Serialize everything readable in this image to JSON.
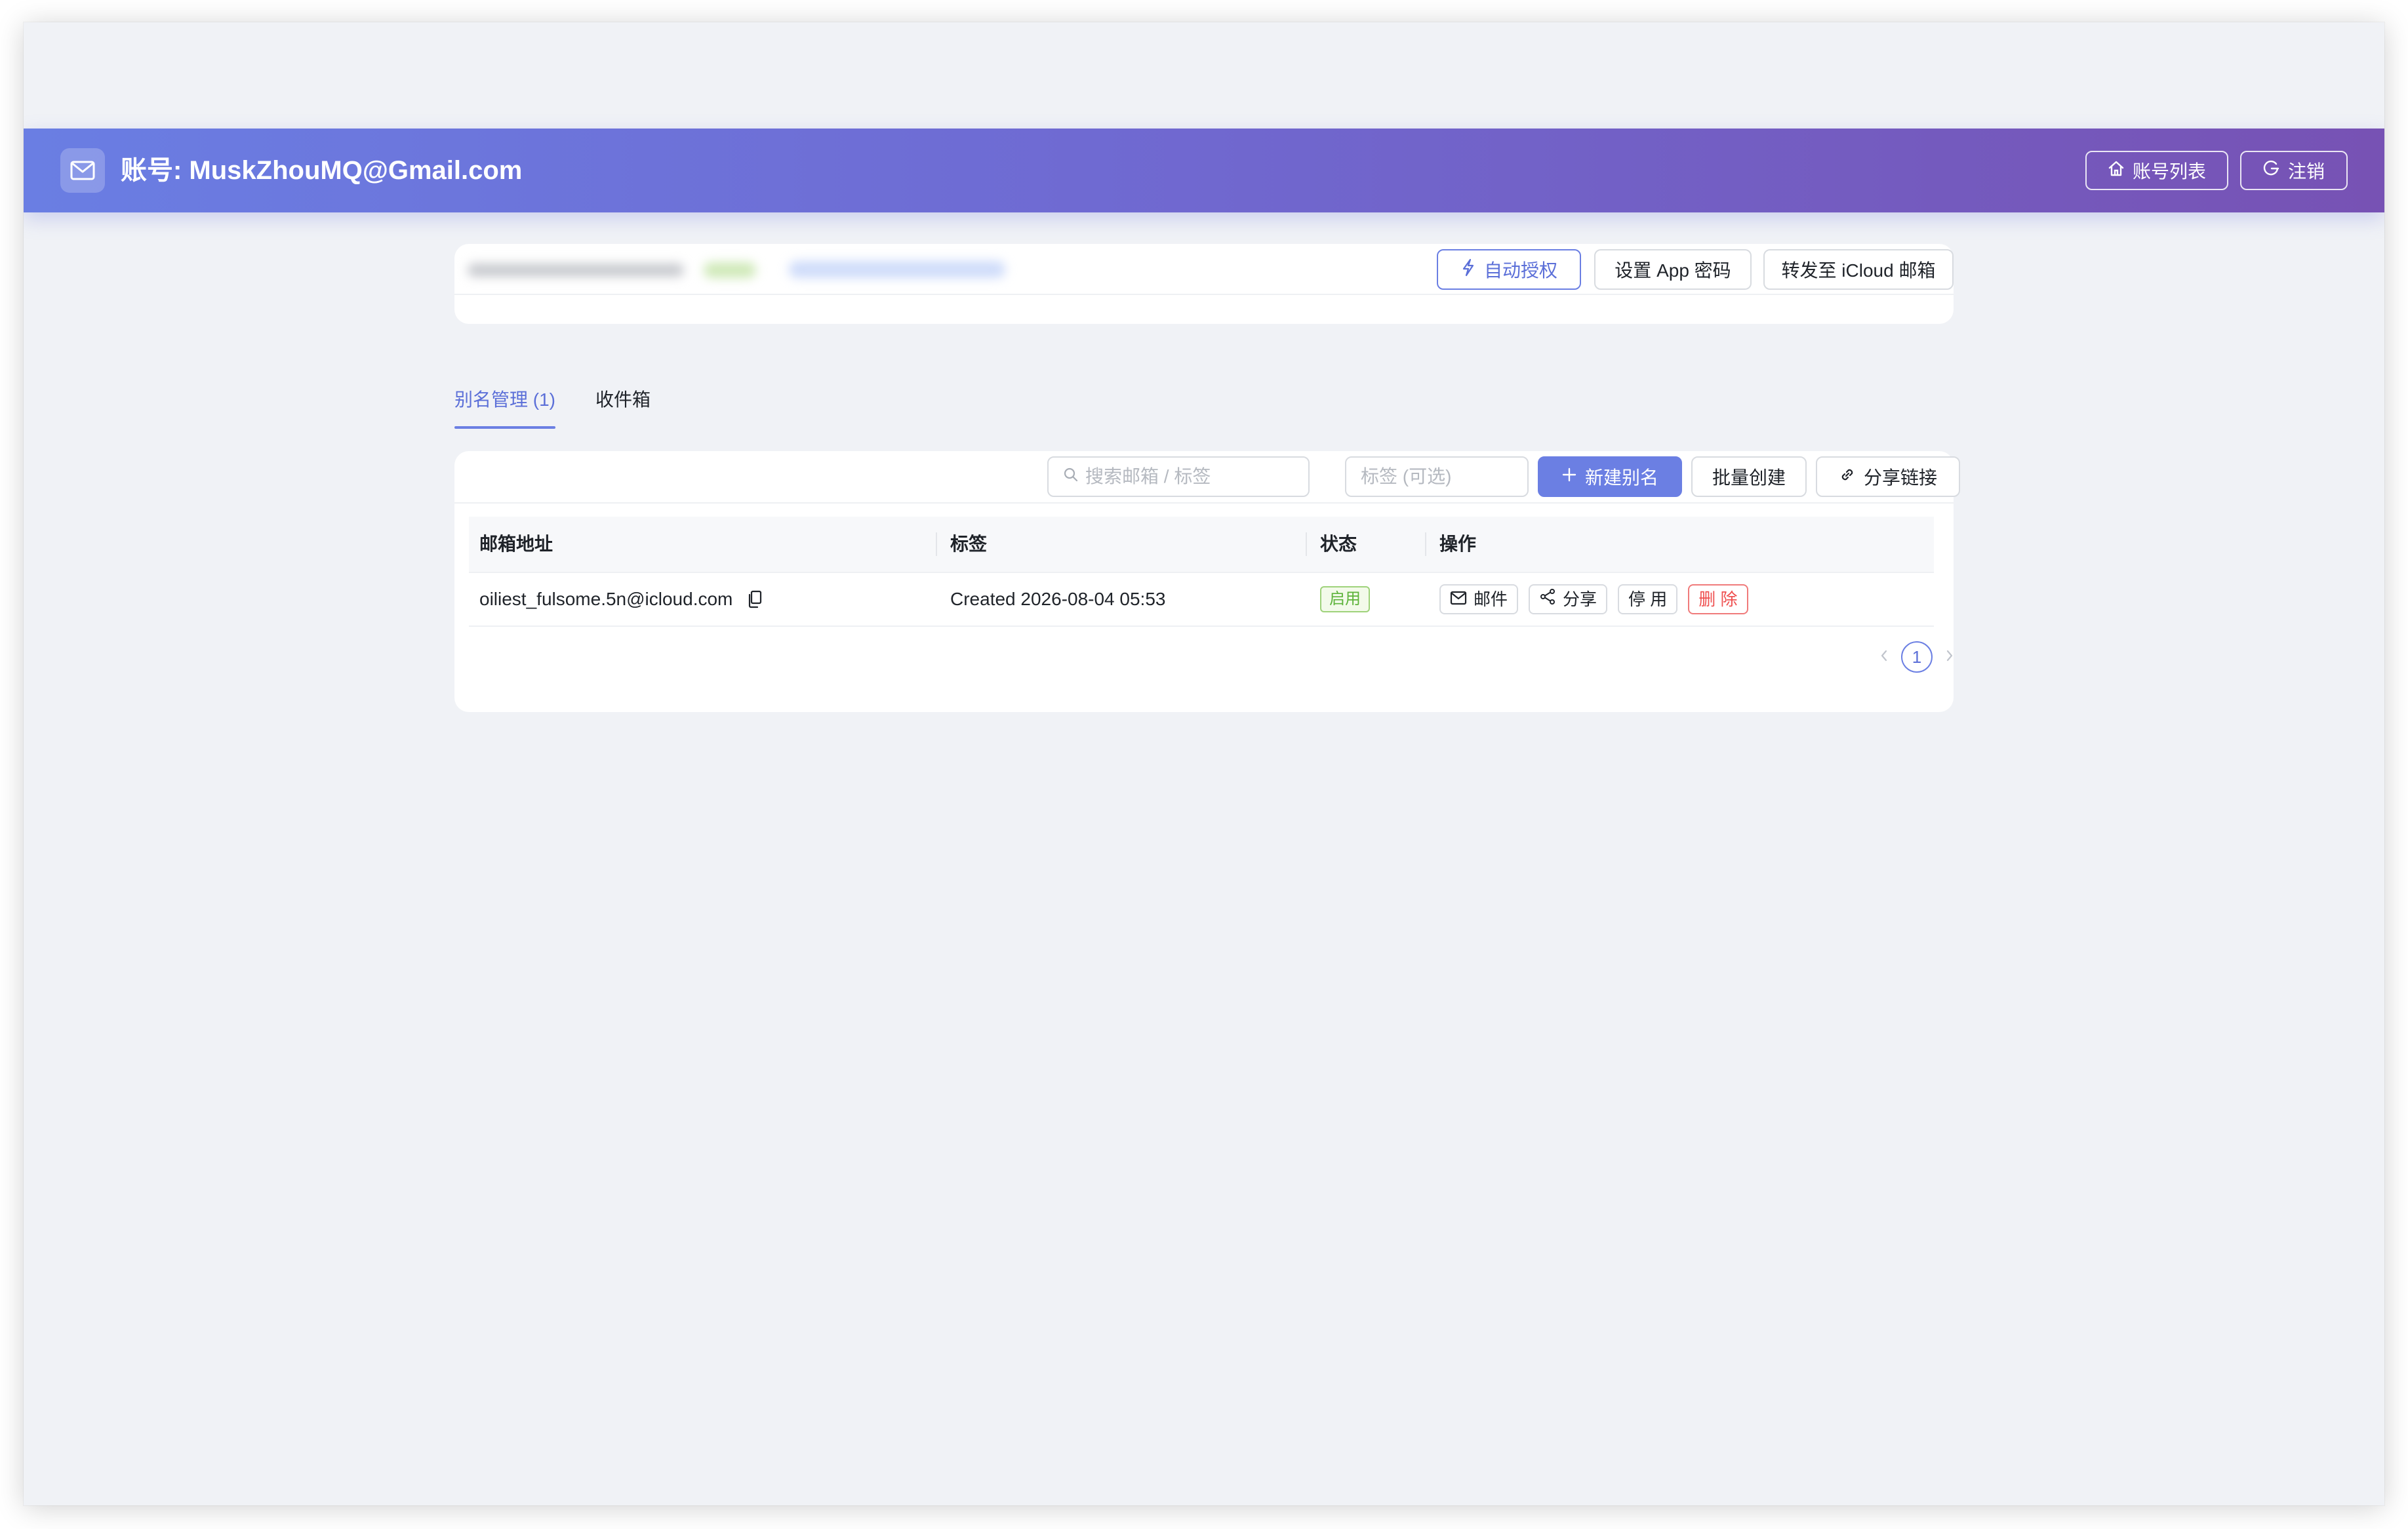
{
  "header": {
    "title": "账号: MuskZhouMQ@Gmail.com",
    "account_list_label": "账号列表",
    "logout_label": "注销"
  },
  "top_card": {
    "auto_auth_label": "自动授权",
    "set_app_password_label": "设置 App 密码",
    "forward_label": "转发至 iCloud 邮箱"
  },
  "tabs": [
    {
      "label": "别名管理 (1)",
      "active": true
    },
    {
      "label": "收件箱",
      "active": false
    }
  ],
  "toolbar": {
    "search_placeholder": "搜索邮箱 / 标签",
    "tag_placeholder": "标签 (可选)",
    "new_alias_label": "新建别名",
    "batch_create_label": "批量创建",
    "share_link_label": "分享链接"
  },
  "table": {
    "columns": [
      "邮箱地址",
      "标签",
      "状态",
      "操作"
    ],
    "rows": [
      {
        "email": "oiliest_fulsome.5n@icloud.com",
        "tag": "Created 2026-08-04 05:53",
        "status": "启用",
        "actions": {
          "mail": "邮件",
          "share": "分享",
          "disable": "停 用",
          "delete": "删 除"
        }
      }
    ]
  },
  "pagination": {
    "current_page": "1"
  },
  "colors": {
    "accent": "#6b7fe3",
    "header_gradient_start": "#6a7ee3",
    "header_gradient_end": "#7752b4",
    "status_enabled": "#5db33a",
    "danger": "#ef5050"
  },
  "icons": {
    "logo": "mail-icon",
    "account_list": "home-icon",
    "logout": "logout-icon",
    "auto_auth": "lightning-icon",
    "search": "search-icon",
    "new_alias": "plus-icon",
    "share_link": "link-icon",
    "copy": "copy-icon",
    "mail_action": "mail-icon",
    "share_action": "share-icon"
  }
}
